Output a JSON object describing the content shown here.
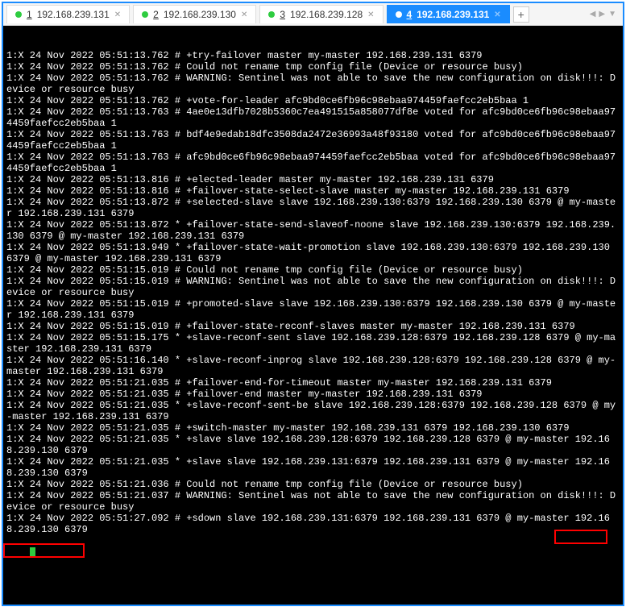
{
  "tabs": {
    "items": [
      {
        "num": "1",
        "label": "192.168.239.131",
        "active": false
      },
      {
        "num": "2",
        "label": "192.168.239.130",
        "active": false
      },
      {
        "num": "3",
        "label": "192.168.239.128",
        "active": false
      },
      {
        "num": "4",
        "label": "192.168.239.131",
        "active": true
      }
    ],
    "add": "+"
  },
  "terminal": {
    "lines": [
      "1:X 24 Nov 2022 05:51:13.762 # +try-failover master my-master 192.168.239.131 6379",
      "1:X 24 Nov 2022 05:51:13.762 # Could not rename tmp config file (Device or resource busy)",
      "1:X 24 Nov 2022 05:51:13.762 # WARNING: Sentinel was not able to save the new configuration on disk!!!: Device or resource busy",
      "1:X 24 Nov 2022 05:51:13.762 # +vote-for-leader afc9bd0ce6fb96c98ebaa974459faefcc2eb5baa 1",
      "1:X 24 Nov 2022 05:51:13.763 # 4ae0e13dfb7028b5360c7ea491515a858077df8e voted for afc9bd0ce6fb96c98ebaa974459faefcc2eb5baa 1",
      "1:X 24 Nov 2022 05:51:13.763 # bdf4e9edab18dfc3508da2472e36993a48f93180 voted for afc9bd0ce6fb96c98ebaa974459faefcc2eb5baa 1",
      "1:X 24 Nov 2022 05:51:13.763 # afc9bd0ce6fb96c98ebaa974459faefcc2eb5baa voted for afc9bd0ce6fb96c98ebaa974459faefcc2eb5baa 1",
      "1:X 24 Nov 2022 05:51:13.816 # +elected-leader master my-master 192.168.239.131 6379",
      "1:X 24 Nov 2022 05:51:13.816 # +failover-state-select-slave master my-master 192.168.239.131 6379",
      "1:X 24 Nov 2022 05:51:13.872 # +selected-slave slave 192.168.239.130:6379 192.168.239.130 6379 @ my-master 192.168.239.131 6379",
      "1:X 24 Nov 2022 05:51:13.872 * +failover-state-send-slaveof-noone slave 192.168.239.130:6379 192.168.239.130 6379 @ my-master 192.168.239.131 6379",
      "1:X 24 Nov 2022 05:51:13.949 * +failover-state-wait-promotion slave 192.168.239.130:6379 192.168.239.130 6379 @ my-master 192.168.239.131 6379",
      "1:X 24 Nov 2022 05:51:15.019 # Could not rename tmp config file (Device or resource busy)",
      "1:X 24 Nov 2022 05:51:15.019 # WARNING: Sentinel was not able to save the new configuration on disk!!!: Device or resource busy",
      "1:X 24 Nov 2022 05:51:15.019 # +promoted-slave slave 192.168.239.130:6379 192.168.239.130 6379 @ my-master 192.168.239.131 6379",
      "1:X 24 Nov 2022 05:51:15.019 # +failover-state-reconf-slaves master my-master 192.168.239.131 6379",
      "1:X 24 Nov 2022 05:51:15.175 * +slave-reconf-sent slave 192.168.239.128:6379 192.168.239.128 6379 @ my-master 192.168.239.131 6379",
      "1:X 24 Nov 2022 05:51:16.140 * +slave-reconf-inprog slave 192.168.239.128:6379 192.168.239.128 6379 @ my-master 192.168.239.131 6379",
      "1:X 24 Nov 2022 05:51:21.035 # +failover-end-for-timeout master my-master 192.168.239.131 6379",
      "1:X 24 Nov 2022 05:51:21.035 # +failover-end master my-master 192.168.239.131 6379",
      "1:X 24 Nov 2022 05:51:21.035 * +slave-reconf-sent-be slave 192.168.239.128:6379 192.168.239.128 6379 @ my-master 192.168.239.131 6379",
      "1:X 24 Nov 2022 05:51:21.035 # +switch-master my-master 192.168.239.131 6379 192.168.239.130 6379",
      "1:X 24 Nov 2022 05:51:21.035 * +slave slave 192.168.239.128:6379 192.168.239.128 6379 @ my-master 192.168.239.130 6379",
      "1:X 24 Nov 2022 05:51:21.035 * +slave slave 192.168.239.131:6379 192.168.239.131 6379 @ my-master 192.168.239.130 6379",
      "1:X 24 Nov 2022 05:51:21.036 # Could not rename tmp config file (Device or resource busy)",
      "1:X 24 Nov 2022 05:51:21.037 # WARNING: Sentinel was not able to save the new configuration on disk!!!: Device or resource busy",
      "1:X 24 Nov 2022 05:51:27.092 # +sdown slave 192.168.239.131:6379 192.168.239.131 6379 @ my-master 192.168.239.130 6379"
    ]
  }
}
